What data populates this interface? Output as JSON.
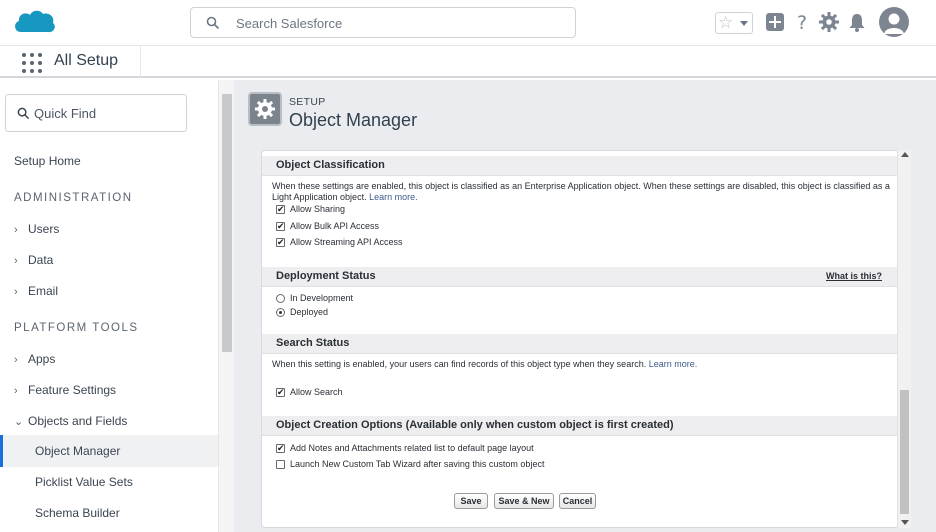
{
  "header": {
    "search_placeholder": "Search Salesforce",
    "icons": [
      "salesforce-cloud-logo",
      "search-icon",
      "favorites-star-icon",
      "global-actions-icon",
      "help-icon",
      "setup-gear-icon",
      "notifications-bell-icon",
      "user-avatar-icon"
    ],
    "colors": {
      "logo": "#1798c1",
      "accent": "#1b6fdc"
    }
  },
  "appbar": {
    "app_name": "All Setup"
  },
  "sidebar": {
    "quick_find_placeholder": "Quick Find",
    "setup_home": "Setup Home",
    "administration_heading": "ADMINISTRATION",
    "admin_items": [
      "Users",
      "Data",
      "Email"
    ],
    "platform_tools_heading": "PLATFORM TOOLS",
    "platform_items": [
      "Apps",
      "Feature Settings",
      "Objects and Fields"
    ],
    "objects_sub_items": [
      "Object Manager",
      "Picklist Value Sets",
      "Schema Builder"
    ],
    "selected": "Object Manager"
  },
  "page": {
    "pretitle": "SETUP",
    "title": "Object Manager"
  },
  "form": {
    "classification": {
      "heading": "Object Classification",
      "description": "When these settings are enabled, this object is classified as an Enterprise Application object. When these settings are disabled, this object is classified as a Light Application object.",
      "learn_more": "Learn more.",
      "options": [
        {
          "label": "Allow Sharing",
          "checked": true
        },
        {
          "label": "Allow Bulk API Access",
          "checked": true
        },
        {
          "label": "Allow Streaming API Access",
          "checked": true
        }
      ]
    },
    "deployment": {
      "heading": "Deployment Status",
      "help_link": "What is this?",
      "options": [
        {
          "label": "In Development",
          "selected": false
        },
        {
          "label": "Deployed",
          "selected": true
        }
      ]
    },
    "search": {
      "heading": "Search Status",
      "description": "When this setting is enabled, your users can find records of this object type when they search.",
      "learn_more": "Learn more.",
      "options": [
        {
          "label": "Allow Search",
          "checked": true
        }
      ]
    },
    "creation": {
      "heading": "Object Creation Options (Available only when custom object is first created)",
      "options": [
        {
          "label": "Add Notes and Attachments related list to default page layout",
          "checked": true
        },
        {
          "label": "Launch New Custom Tab Wizard after saving this custom object",
          "checked": false
        }
      ]
    },
    "buttons": {
      "save": "Save",
      "save_new": "Save & New",
      "cancel": "Cancel"
    }
  }
}
